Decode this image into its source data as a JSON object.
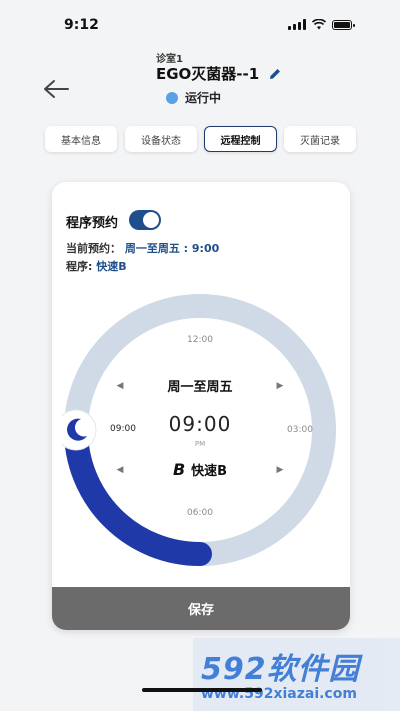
{
  "status_bar": {
    "time": "9:12"
  },
  "header": {
    "room": "诊室1",
    "device_name": "EGO灭菌器--1",
    "status_text": "运行中",
    "status_color": "#5aa0e6"
  },
  "tabs": [
    {
      "label": "基本信息"
    },
    {
      "label": "设备状态"
    },
    {
      "label": "远程控制"
    },
    {
      "label": "灭菌记录"
    }
  ],
  "active_tab": "远程控制",
  "schedule": {
    "title": "程序预约",
    "enabled": true,
    "current_label": "当前预约：",
    "current_value": "周一至周五 : 9:00",
    "program_label": "程序:",
    "program_value": "快速B"
  },
  "dial": {
    "label_12": "12:00",
    "label_3": "03:00",
    "label_6": "06:00",
    "label_9": "09:00",
    "days": "周一至周五",
    "time": "09:00",
    "ampm": "PM",
    "program": "快速B",
    "program_icon": "B",
    "track_color": "#cfdae6",
    "progress_color": "#1f3aa8",
    "icon": "moon-icon"
  },
  "actions": {
    "save": "保存"
  },
  "watermark": {
    "brand": "592软件园",
    "url": "www.592xiazai.com"
  },
  "colors": {
    "accent": "#1f4e8c",
    "save_button": "#6b6b6b"
  }
}
